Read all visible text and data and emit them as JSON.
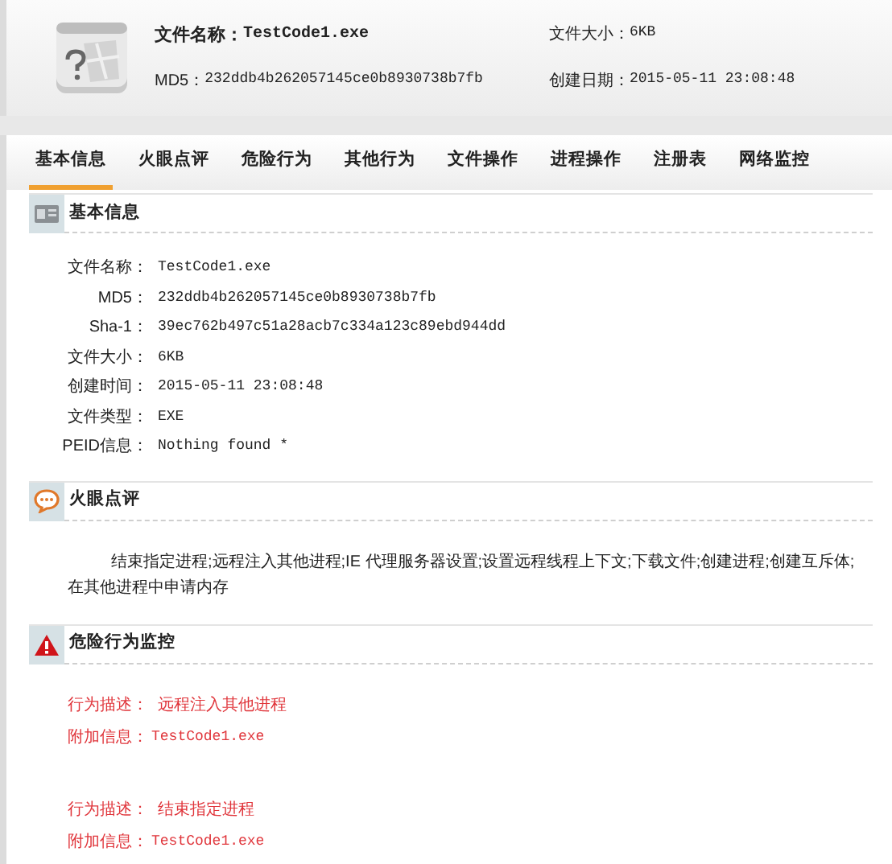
{
  "header": {
    "file_name_label": "文件名称：",
    "file_name": "TestCode1.exe",
    "md5_label": "MD5：",
    "md5": "232ddb4b262057145ce0b8930738b7fb",
    "size_label": "文件大小：",
    "size": "6KB",
    "date_label": "创建日期：",
    "date": "2015-05-11 23:08:48"
  },
  "tabs": [
    {
      "label": "基本信息",
      "selected": true
    },
    {
      "label": "火眼点评",
      "selected": false
    },
    {
      "label": "危险行为",
      "selected": false
    },
    {
      "label": "其他行为",
      "selected": false
    },
    {
      "label": "文件操作",
      "selected": false
    },
    {
      "label": "进程操作",
      "selected": false
    },
    {
      "label": "注册表",
      "selected": false
    },
    {
      "label": "网络监控",
      "selected": false
    }
  ],
  "sections": [
    {
      "kind": "info",
      "title": "基本信息",
      "fields": [
        {
          "label": "文件名称：",
          "value": "TestCode1.exe"
        },
        {
          "label": "MD5：",
          "value": "232ddb4b262057145ce0b8930738b7fb"
        },
        {
          "label": "Sha-1：",
          "value": "39ec762b497c51a28acb7c334a123c89ebd944dd"
        },
        {
          "label": "文件大小：",
          "value": "6KB"
        },
        {
          "label": "创建时间：",
          "value": "2015-05-11 23:08:48"
        },
        {
          "label": "文件类型：",
          "value": "EXE"
        },
        {
          "label": "PEID信息：",
          "value": "Nothing found *"
        }
      ]
    },
    {
      "kind": "comment",
      "title": "火眼点评",
      "text": "结束指定进程;远程注入其他进程;IE 代理服务器设置;设置远程线程上下文;下载文件;创建进程;创建互斥体;在其他进程中申请内存"
    },
    {
      "kind": "danger",
      "title": "危险行为监控",
      "entries": [
        {
          "desc_label": "行为描述：",
          "desc": "远程注入其他进程",
          "extra_label": "附加信息：",
          "extra": "TestCode1.exe"
        },
        {
          "desc_label": "行为描述：",
          "desc": "结束指定进程",
          "extra_label": "附加信息：",
          "extra": "TestCode1.exe"
        }
      ]
    }
  ]
}
